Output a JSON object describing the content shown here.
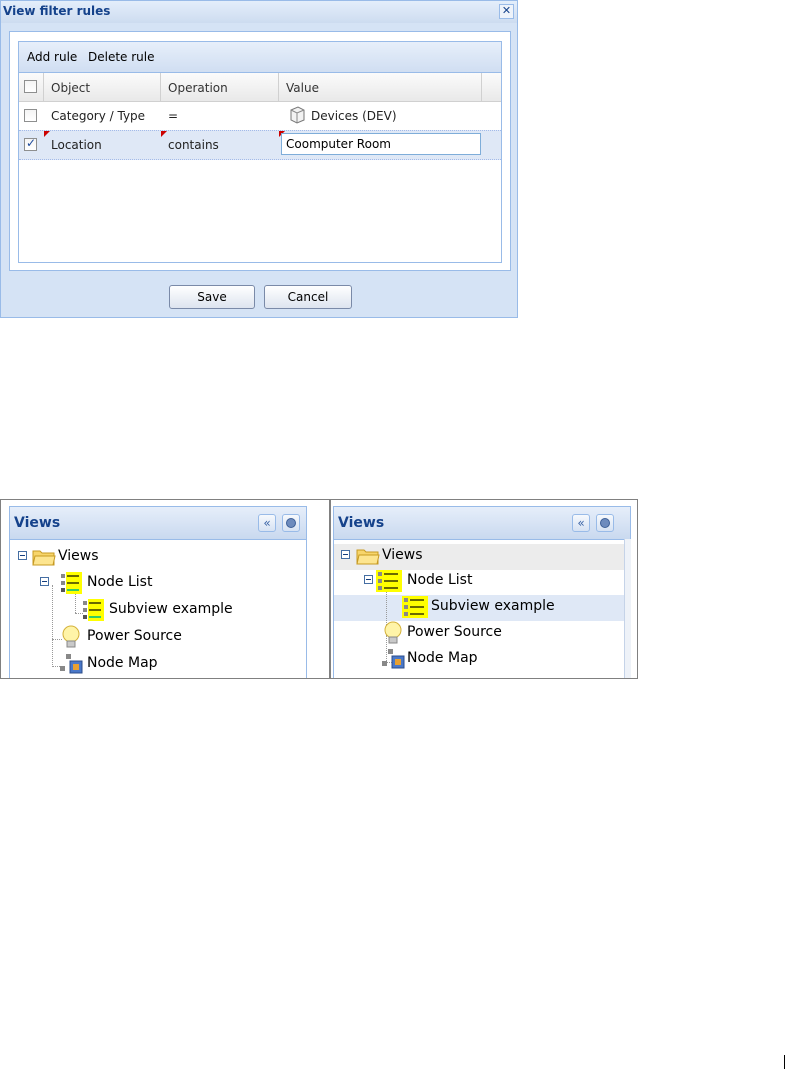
{
  "dialog": {
    "title": "View filter rules",
    "close_glyph": "✕",
    "toolbar": {
      "add_rule": "Add rule",
      "delete_rule": "Delete rule"
    },
    "columns": [
      "Object",
      "Operation",
      "Value"
    ],
    "rows": [
      {
        "checked": false,
        "object": "Category / Type",
        "operation": "=",
        "value": "Devices (DEV)",
        "value_icon": "device-box-icon"
      },
      {
        "checked": true,
        "object": "Location",
        "operation": "contains",
        "value": "Coomputer Room",
        "editing": true
      }
    ],
    "buttons": {
      "save": "Save",
      "cancel": "Cancel"
    }
  },
  "views_left": {
    "title": "Views",
    "tools": {
      "collapse": "«",
      "settings": "●"
    },
    "tree": {
      "root": "Views",
      "node_list": "Node List",
      "subview": "Subview example",
      "power_source": "Power Source",
      "node_map": "Node Map"
    }
  },
  "views_right": {
    "title": "Views",
    "tools": {
      "collapse": "«",
      "settings": "●"
    },
    "tree": {
      "root": "Views",
      "node_list": "Node List",
      "subview": "Subview example",
      "power_source": "Power Source",
      "node_map": "Node Map"
    },
    "selected": "Subview example"
  },
  "colors": {
    "accent": "#15428b",
    "selection": "#dfe8f6",
    "highlight": "#ffff00"
  }
}
